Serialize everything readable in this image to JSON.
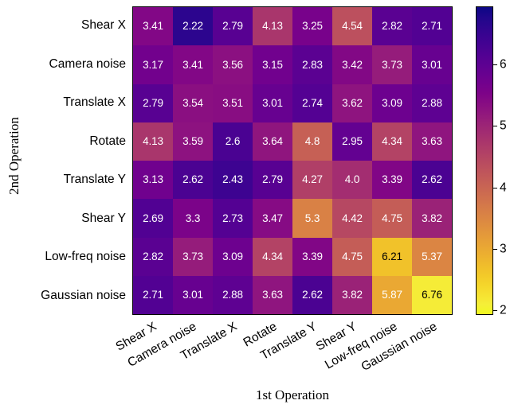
{
  "chart_data": {
    "type": "heatmap",
    "title": "",
    "xlabel": "1st Operation",
    "ylabel": "2nd Operation",
    "x_categories": [
      "Shear X",
      "Camera noise",
      "Translate X",
      "Rotate",
      "Translate Y",
      "Shear Y",
      "Low-freq noise",
      "Gaussian noise"
    ],
    "y_categories": [
      "Shear X",
      "Camera noise",
      "Translate X",
      "Rotate",
      "Translate Y",
      "Shear Y",
      "Low-freq noise",
      "Gaussian noise"
    ],
    "values": [
      [
        3.41,
        2.22,
        2.79,
        4.13,
        3.25,
        4.54,
        2.82,
        2.71
      ],
      [
        3.17,
        3.41,
        3.56,
        3.15,
        2.83,
        3.42,
        3.73,
        3.01
      ],
      [
        2.79,
        3.54,
        3.51,
        3.01,
        2.74,
        3.62,
        3.09,
        2.88
      ],
      [
        4.13,
        3.59,
        2.6,
        3.64,
        4.8,
        2.95,
        4.34,
        3.63
      ],
      [
        3.13,
        2.62,
        2.43,
        2.79,
        4.27,
        4.0,
        3.39,
        2.62
      ],
      [
        2.69,
        3.3,
        2.73,
        3.47,
        5.3,
        4.42,
        4.75,
        3.82
      ],
      [
        2.82,
        3.73,
        3.09,
        4.34,
        3.39,
        4.75,
        6.21,
        5.37
      ],
      [
        2.71,
        3.01,
        2.88,
        3.63,
        2.62,
        3.82,
        5.87,
        6.76
      ]
    ],
    "value_labels": [
      [
        "3.41",
        "2.22",
        "2.79",
        "4.13",
        "3.25",
        "4.54",
        "2.82",
        "2.71"
      ],
      [
        "3.17",
        "3.41",
        "3.56",
        "3.15",
        "2.83",
        "3.42",
        "3.73",
        "3.01"
      ],
      [
        "2.79",
        "3.54",
        "3.51",
        "3.01",
        "2.74",
        "3.62",
        "3.09",
        "2.88"
      ],
      [
        "4.13",
        "3.59",
        "2.6",
        "3.64",
        "4.8",
        "2.95",
        "4.34",
        "3.63"
      ],
      [
        "3.13",
        "2.62",
        "2.43",
        "2.79",
        "4.27",
        "4.0",
        "3.39",
        "2.62"
      ],
      [
        "2.69",
        "3.3",
        "2.73",
        "3.47",
        "5.3",
        "4.42",
        "4.75",
        "3.82"
      ],
      [
        "2.82",
        "3.73",
        "3.09",
        "4.34",
        "3.39",
        "4.75",
        "6.21",
        "5.37"
      ],
      [
        "2.71",
        "3.01",
        "2.88",
        "3.63",
        "2.62",
        "3.82",
        "5.87",
        "6.76"
      ]
    ],
    "colormap": "plasma",
    "colorbar": {
      "vmin": 1.92,
      "vmax": 6.95,
      "ticks": [
        2,
        3,
        4,
        5,
        6
      ],
      "tick_labels": [
        "2",
        "3",
        "4",
        "5",
        "6"
      ],
      "position": "right"
    },
    "grid": false,
    "annotations_shown": true
  },
  "axes": {
    "xlabel": "1st Operation",
    "ylabel": "2nd Operation"
  }
}
